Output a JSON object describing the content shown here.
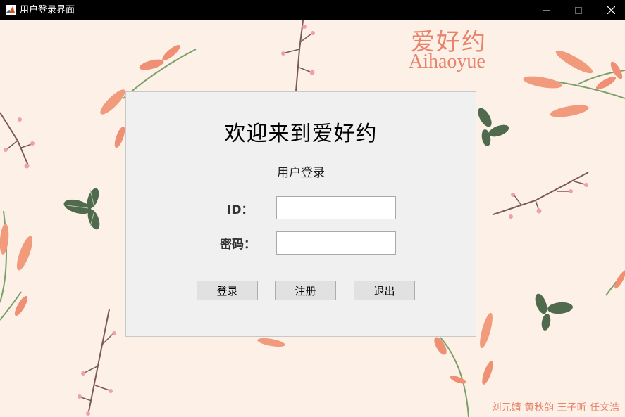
{
  "window": {
    "title": "用户登录界面",
    "app_icon": "matlab-icon",
    "controls": {
      "minimize": "minimize-icon",
      "maximize": "maximize-icon",
      "close": "close-icon"
    }
  },
  "branding": {
    "logo_cn": "爱好约",
    "logo_en": "Aihaoyue",
    "authors": "刘元婧  黄秋韵  王子昕  任文浩"
  },
  "login": {
    "heading": "欢迎来到爱好约",
    "subheading": "用户登录",
    "id_label": "ID：",
    "id_value": "",
    "password_label": "密码：",
    "password_value": "",
    "buttons": {
      "login": "登录",
      "register": "注册",
      "exit": "退出"
    }
  },
  "colors": {
    "titlebar": "#000000",
    "background": "#fdf1e7",
    "panel": "#f0f0f0",
    "accent": "#e8836c",
    "leaf_green": "#4a5e48",
    "stem": "#7a5a52"
  }
}
